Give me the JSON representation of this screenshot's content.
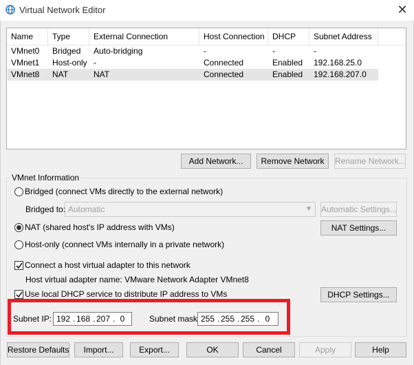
{
  "window": {
    "title": "Virtual Network Editor",
    "icon": "globe-icon",
    "close_glyph": "✕"
  },
  "list": {
    "columns": [
      "Name",
      "Type",
      "External Connection",
      "Host Connection",
      "DHCP",
      "Subnet Address"
    ],
    "rows": [
      {
        "name": "VMnet0",
        "type": "Bridged",
        "external": "Auto-bridging",
        "host": "-",
        "dhcp": "-",
        "subnet": "-",
        "selected": false
      },
      {
        "name": "VMnet1",
        "type": "Host-only",
        "external": "-",
        "host": "Connected",
        "dhcp": "Enabled",
        "subnet": "192.168.25.0",
        "selected": false
      },
      {
        "name": "VMnet8",
        "type": "NAT",
        "external": "NAT",
        "host": "Connected",
        "dhcp": "Enabled",
        "subnet": "192.168.207.0",
        "selected": true
      }
    ]
  },
  "network_buttons": {
    "add": "Add Network...",
    "remove": "Remove Network",
    "rename": "Rename Network..."
  },
  "vmnet_info": {
    "group_label": "VMnet Information",
    "bridged_label": "Bridged (connect VMs directly to the external network)",
    "bridged_to_label": "Bridged to:",
    "bridged_to_value": "Automatic",
    "automatic_settings": "Automatic Settings...",
    "nat_label": "NAT (shared host's IP address with VMs)",
    "nat_settings": "NAT Settings...",
    "hostonly_label": "Host-only (connect VMs internally in a private network)",
    "connect_adapter_label": "Connect a host virtual adapter to this network",
    "adapter_name_label": "Host virtual adapter name: VMware Network Adapter VMnet8",
    "dhcp_label": "Use local DHCP service to distribute IP address to VMs",
    "dhcp_settings": "DHCP Settings...",
    "selected_mode": "nat",
    "connect_adapter_checked": true,
    "dhcp_checked": true,
    "subnet_ip_label": "Subnet IP:",
    "subnet_ip": [
      "192",
      "168",
      "207",
      "0"
    ],
    "subnet_mask_label": "Subnet mask:",
    "subnet_mask": [
      "255",
      "255",
      "255",
      "0"
    ],
    "highlight_color": "#ec1c24"
  },
  "footer": {
    "restore": "Restore Defaults",
    "import": "Import...",
    "export": "Export...",
    "ok": "OK",
    "cancel": "Cancel",
    "apply": "Apply",
    "help": "Help"
  }
}
